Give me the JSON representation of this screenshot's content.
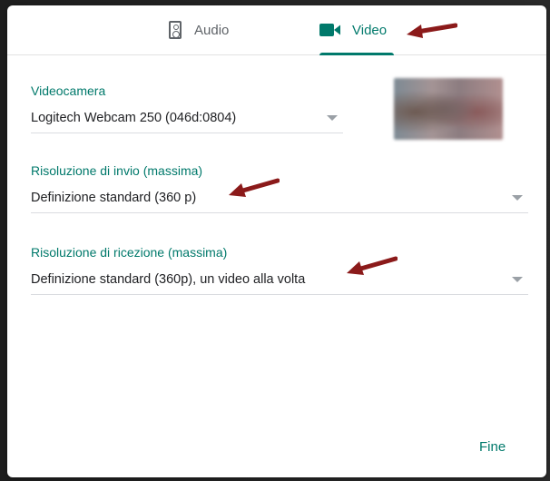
{
  "tabs": {
    "audio_label": "Audio",
    "video_label": "Video",
    "active": "video",
    "accent_color": "#00796b"
  },
  "camera": {
    "label": "Videocamera",
    "value": "Logitech Webcam 250 (046d:0804)"
  },
  "send_resolution": {
    "label": "Risoluzione di invio (massima)",
    "value": "Definizione standard (360 p)"
  },
  "receive_resolution": {
    "label": "Risoluzione di ricezione (massima)",
    "value": "Definizione standard (360p), un video alla volta"
  },
  "footer": {
    "done_label": "Fine"
  },
  "annotations": {
    "arrow_color": "#8b1a1a"
  }
}
